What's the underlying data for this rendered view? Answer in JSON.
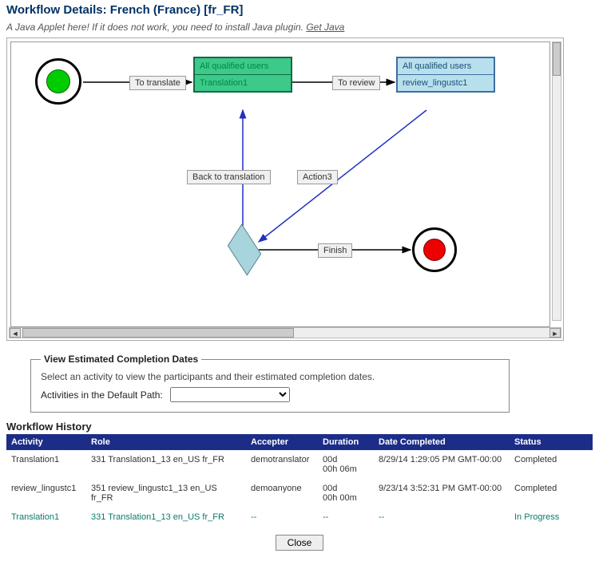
{
  "page_title": "Workflow Details: French (France) [fr_FR]",
  "applet_hint": "A Java Applet here! If it does not work, you need to install Java plugin. ",
  "get_java_link": "Get Java",
  "diagram": {
    "start": {
      "type": "start"
    },
    "end": {
      "type": "end"
    },
    "translate_task": {
      "line1": "All qualified users",
      "line2": "Translation1"
    },
    "review_task": {
      "line1": "All qualified users",
      "line2": "review_lingustc1"
    },
    "labels": {
      "to_translate": "To translate",
      "to_review": "To review",
      "back_to_translation": "Back to translation",
      "action3": "Action3",
      "finish": "Finish"
    }
  },
  "dates_panel": {
    "legend": "View Estimated Completion Dates",
    "hint": "Select an activity to view the participants and their estimated completion dates.",
    "label": "Activities in the Default Path:",
    "selected": ""
  },
  "history": {
    "title": "Workflow History",
    "headers": {
      "activity": "Activity",
      "role": "Role",
      "accepter": "Accepter",
      "duration": "Duration",
      "date_completed": "Date Completed",
      "status": "Status"
    },
    "rows": [
      {
        "activity": "Translation1",
        "role": "331 Translation1_13 en_US fr_FR",
        "accepter": "demotranslator",
        "duration": "00d 00h 06m",
        "date_completed": "8/29/14 1:29:05 PM GMT-00:00",
        "status": "Completed",
        "in_progress": false
      },
      {
        "activity": "review_lingustc1",
        "role": "351 review_lingustc1_13 en_US fr_FR",
        "accepter": "demoanyone",
        "duration": "00d 00h 00m",
        "date_completed": "9/23/14 3:52:31 PM GMT-00:00",
        "status": "Completed",
        "in_progress": false
      },
      {
        "activity": "Translation1",
        "role": "331 Translation1_13 en_US fr_FR",
        "accepter": "--",
        "duration": "--",
        "date_completed": "--",
        "status": "In Progress",
        "in_progress": true
      }
    ]
  },
  "close_label": "Close"
}
